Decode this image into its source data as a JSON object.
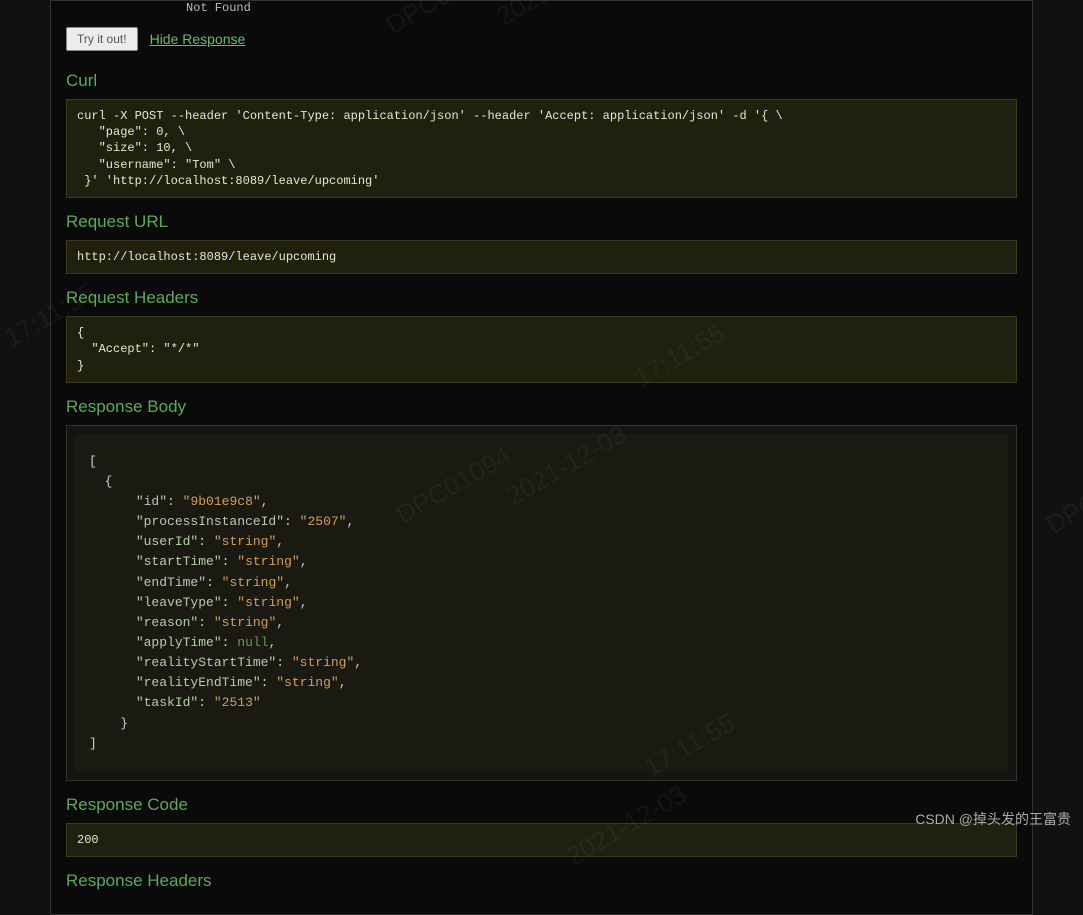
{
  "top": {
    "notFound": "Not Found",
    "tryButton": "Try it out!",
    "hideLink": "Hide Response"
  },
  "sections": {
    "curl": {
      "title": "Curl",
      "content": "curl -X POST --header 'Content-Type: application/json' --header 'Accept: application/json' -d '{ \\\n   \"page\": 0, \\\n   \"size\": 10, \\\n   \"username\": \"Tom\" \\\n }' 'http://localhost:8089/leave/upcoming'"
    },
    "requestUrl": {
      "title": "Request URL",
      "content": "http://localhost:8089/leave/upcoming"
    },
    "requestHeaders": {
      "title": "Request Headers",
      "content": "{\n  \"Accept\": \"*/*\"\n}"
    },
    "responseBody": {
      "title": "Response Body",
      "json": [
        {
          "id": "9b01e9c8",
          "processInstanceId": "2507",
          "userId": "string",
          "startTime": "string",
          "endTime": "string",
          "leaveType": "string",
          "reason": "string",
          "applyTime": null,
          "realityStartTime": "string",
          "realityEndTime": "string",
          "taskId": "2513"
        }
      ]
    },
    "responseCode": {
      "title": "Response Code",
      "content": "200"
    },
    "responseHeaders": {
      "title": "Response Headers"
    }
  },
  "watermark": "CSDN @掉头发的王富贵",
  "diagWatermarks": [
    "DPC01094",
    "2021-12-03",
    "17:11:55"
  ]
}
